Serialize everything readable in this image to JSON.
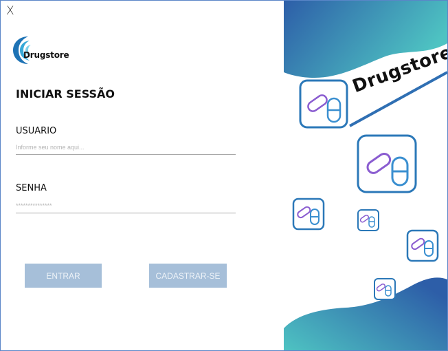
{
  "window": {
    "close_label": "X"
  },
  "logo": {
    "text": "Drugstore"
  },
  "login": {
    "title": "INICIAR SESSÃO",
    "username_label": "USUARIO",
    "username_placeholder": "Informe seu nome aqui...",
    "password_label": "SENHA",
    "password_mask": "***************"
  },
  "actions": {
    "enter_label": "ENTRAR",
    "register_label": "CADASTRAR-SE"
  },
  "banner": {
    "brand_text": "Drugstore"
  },
  "colors": {
    "accent": "#2f8fc6",
    "gradient_start": "#2d5ea8",
    "gradient_end": "#4ec3c2",
    "button_bg": "#a6bfd9",
    "pill_purple": "#8a5cd0"
  }
}
